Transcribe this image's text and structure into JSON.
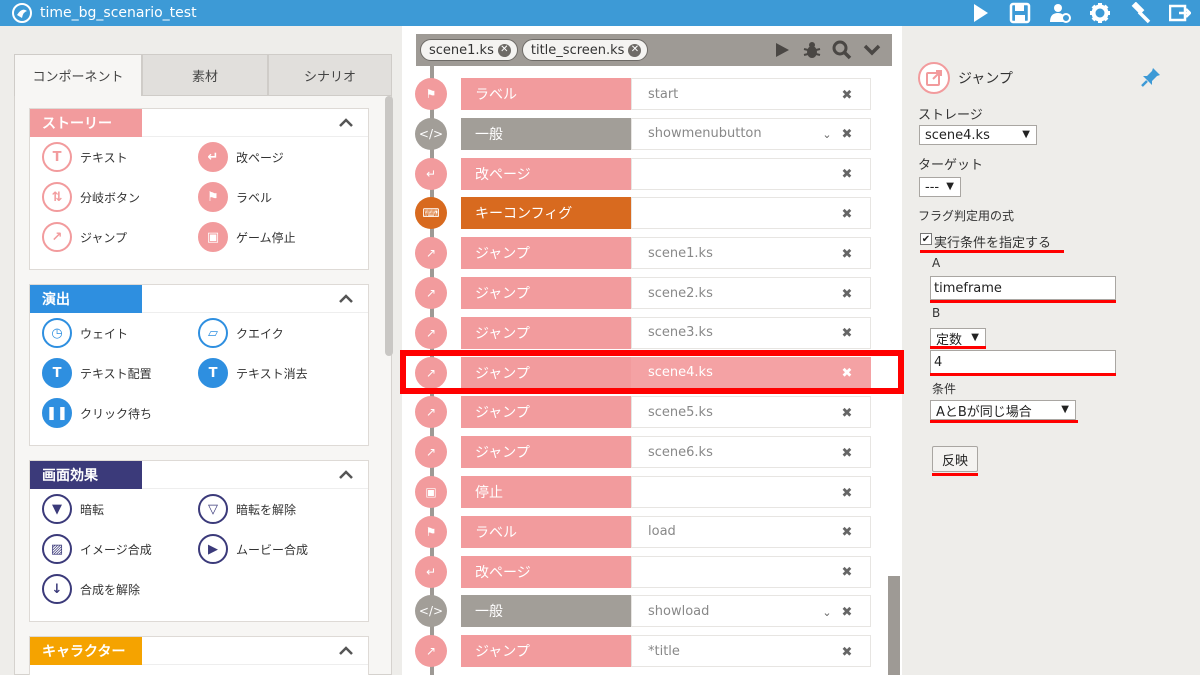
{
  "app": {
    "title": "time_bg_scenario_test"
  },
  "toolbar": {
    "icons": [
      "play-icon",
      "save-icon",
      "users-gear-icon",
      "gear-icon",
      "hammer-icon",
      "export-icon"
    ]
  },
  "left_tabs": [
    {
      "label": "コンポーネント",
      "active": true
    },
    {
      "label": "素材",
      "active": false
    },
    {
      "label": "シナリオ",
      "active": false
    }
  ],
  "categories": [
    {
      "label": "ストーリー",
      "color": "#f29b9d",
      "items": [
        {
          "label": "テキスト",
          "icon": "text-icon"
        },
        {
          "label": "改ページ",
          "icon": "page-break-icon"
        },
        {
          "label": "分岐ボタン",
          "icon": "branch-icon"
        },
        {
          "label": "ラベル",
          "icon": "flag-icon"
        },
        {
          "label": "ジャンプ",
          "icon": "jump-icon"
        },
        {
          "label": "ゲーム停止",
          "icon": "stop-icon"
        }
      ]
    },
    {
      "label": "演出",
      "color": "#2e8fe0",
      "items": [
        {
          "label": "ウェイト",
          "icon": "clock-icon"
        },
        {
          "label": "クエイク",
          "icon": "quake-icon"
        },
        {
          "label": "テキスト配置",
          "icon": "text-place-icon"
        },
        {
          "label": "テキスト消去",
          "icon": "text-erase-icon"
        },
        {
          "label": "クリック待ち",
          "icon": "pause-icon"
        }
      ]
    },
    {
      "label": "画面効果",
      "color": "#3b3a7a",
      "items": [
        {
          "label": "暗転",
          "icon": "fade-out-icon"
        },
        {
          "label": "暗転を解除",
          "icon": "fade-in-icon"
        },
        {
          "label": "イメージ合成",
          "icon": "image-icon"
        },
        {
          "label": "ムービー合成",
          "icon": "movie-icon"
        },
        {
          "label": "合成を解除",
          "icon": "unmerge-icon"
        }
      ]
    },
    {
      "label": "キャラクター",
      "color": "#f5a300",
      "items": []
    }
  ],
  "file_tabs": [
    {
      "label": "scene1.ks"
    },
    {
      "label": "title_screen.ks"
    }
  ],
  "file_tools": [
    "play-icon",
    "bug-icon",
    "search-icon",
    "chevron-down-icon"
  ],
  "scenario_rows": [
    {
      "label": "ラベル",
      "value": "start",
      "color": "#f29b9d",
      "node_color": "#f29b9d",
      "icon": "flag-icon",
      "chevron": false
    },
    {
      "label": "一般",
      "value": "showmenubutton",
      "color": "#a29e98",
      "node_color": "#a29e98",
      "icon": "code-icon",
      "chevron": true
    },
    {
      "label": "改ページ",
      "value": "",
      "color": "#f29b9d",
      "node_color": "#f29b9d",
      "icon": "page-break-icon",
      "chevron": false
    },
    {
      "label": "キーコンフィグ",
      "value": "",
      "color": "#d86a1f",
      "node_color": "#d86a1f",
      "icon": "keyboard-icon",
      "chevron": false
    },
    {
      "label": "ジャンプ",
      "value": "scene1.ks",
      "color": "#f29b9d",
      "node_color": "#f29b9d",
      "icon": "jump-icon",
      "chevron": false
    },
    {
      "label": "ジャンプ",
      "value": "scene2.ks",
      "color": "#f29b9d",
      "node_color": "#f29b9d",
      "icon": "jump-icon",
      "chevron": false
    },
    {
      "label": "ジャンプ",
      "value": "scene3.ks",
      "color": "#f29b9d",
      "node_color": "#f29b9d",
      "icon": "jump-icon",
      "chevron": false
    },
    {
      "label": "ジャンプ",
      "value": "scene4.ks",
      "color": "#f29b9d",
      "node_color": "#f29b9d",
      "icon": "jump-icon",
      "chevron": false,
      "selected": true
    },
    {
      "label": "ジャンプ",
      "value": "scene5.ks",
      "color": "#f29b9d",
      "node_color": "#f29b9d",
      "icon": "jump-icon",
      "chevron": false
    },
    {
      "label": "ジャンプ",
      "value": "scene6.ks",
      "color": "#f29b9d",
      "node_color": "#f29b9d",
      "icon": "jump-icon",
      "chevron": false
    },
    {
      "label": "停止",
      "value": "",
      "color": "#f29b9d",
      "node_color": "#f29b9d",
      "icon": "stop-icon",
      "chevron": false
    },
    {
      "label": "ラベル",
      "value": "load",
      "color": "#f29b9d",
      "node_color": "#f29b9d",
      "icon": "flag-icon",
      "chevron": false
    },
    {
      "label": "改ページ",
      "value": "",
      "color": "#f29b9d",
      "node_color": "#f29b9d",
      "icon": "page-break-icon",
      "chevron": false
    },
    {
      "label": "一般",
      "value": "showload",
      "color": "#a29e98",
      "node_color": "#a29e98",
      "icon": "code-icon",
      "chevron": true
    },
    {
      "label": "ジャンプ",
      "value": "*title",
      "color": "#f29b9d",
      "node_color": "#f29b9d",
      "icon": "jump-icon",
      "chevron": false
    }
  ],
  "props": {
    "title": "ジャンプ",
    "storage_label": "ストレージ",
    "storage_value": "scene4.ks",
    "target_label": "ターゲット",
    "target_value": "---",
    "flag_label": "フラグ判定用の式",
    "condition_check_label": "実行条件を指定する",
    "condition_checked": true,
    "a_label": "A",
    "a_value": "timeframe",
    "b_label": "B",
    "b_type": "定数",
    "b_value": "4",
    "cond_label": "条件",
    "cond_value": "AとBが同じ場合",
    "apply_label": "反映"
  }
}
